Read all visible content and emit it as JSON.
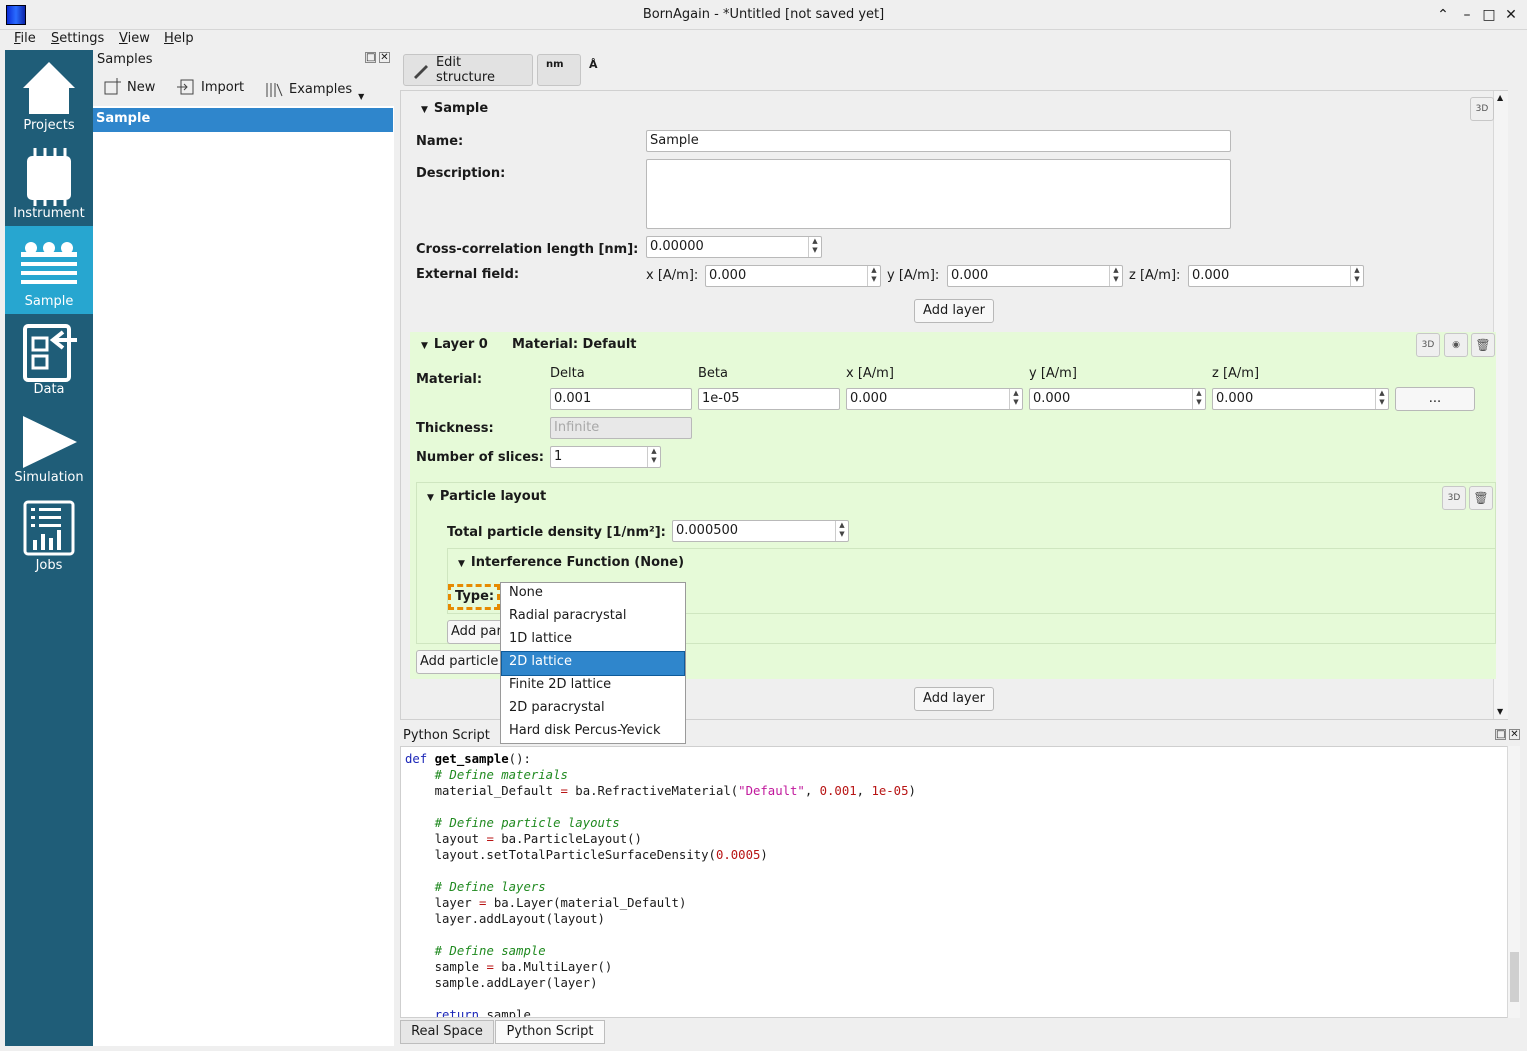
{
  "window": {
    "title": "BornAgain - *Untitled [not saved yet]"
  },
  "menubar": [
    "File",
    "Settings",
    "View",
    "Help"
  ],
  "nav": [
    {
      "label": "Projects",
      "icon": "home-icon"
    },
    {
      "label": "Instrument",
      "icon": "chip-icon"
    },
    {
      "label": "Sample",
      "icon": "layers-icon",
      "active": true
    },
    {
      "label": "Data",
      "icon": "data-import-icon"
    },
    {
      "label": "Simulation",
      "icon": "play-icon"
    },
    {
      "label": "Jobs",
      "icon": "jobs-icon"
    }
  ],
  "samples": {
    "title": "Samples",
    "new_label": "New",
    "import_label": "Import",
    "examples_label": "Examples",
    "items": [
      "Sample"
    ]
  },
  "toolbar": {
    "edit_structure": "Edit structure",
    "unit_nm": "nm",
    "unit_a": "Å"
  },
  "sample": {
    "header": "Sample",
    "name_label": "Name:",
    "name_value": "Sample",
    "description_label": "Description:",
    "description_value": "",
    "crosscorr_label": "Cross-correlation length [nm]:",
    "crosscorr_value": "0.00000",
    "extfield_label": "External field:",
    "x_label": "x [A/m]:",
    "x_value": "0.000",
    "y_label": "y [A/m]:",
    "y_value": "0.000",
    "z_label": "z [A/m]:",
    "z_value": "0.000",
    "add_layer": "Add layer"
  },
  "layer": {
    "header": "Layer 0",
    "material_header": "Material: Default",
    "material_label": "Material:",
    "cols": [
      "Delta",
      "Beta",
      "x [A/m]",
      "y [A/m]",
      "z [A/m]"
    ],
    "values": [
      "0.001",
      "1e-05",
      "0.000",
      "0.000",
      "0.000"
    ],
    "more_button": "...",
    "thickness_label": "Thickness:",
    "thickness_placeholder": "Infinite",
    "slices_label": "Number of slices:",
    "slices_value": "1",
    "add_particle": "Add particle"
  },
  "particle_layout": {
    "header": "Particle layout",
    "density_label": "Total particle density [1/nm²]:",
    "density_value": "0.000500",
    "interference_header": "Interference Function (None)",
    "type_label": "Type:",
    "add_particle_inner": "Add par"
  },
  "dropdown": {
    "options": [
      "None",
      "Radial paracrystal",
      "1D lattice",
      "2D lattice",
      "Finite 2D lattice",
      "2D paracrystal",
      "Hard disk Percus-Yevick"
    ],
    "highlighted": "2D lattice"
  },
  "python": {
    "title": "Python Script"
  },
  "bottom_tabs": [
    "Real Space",
    "Python Script"
  ]
}
